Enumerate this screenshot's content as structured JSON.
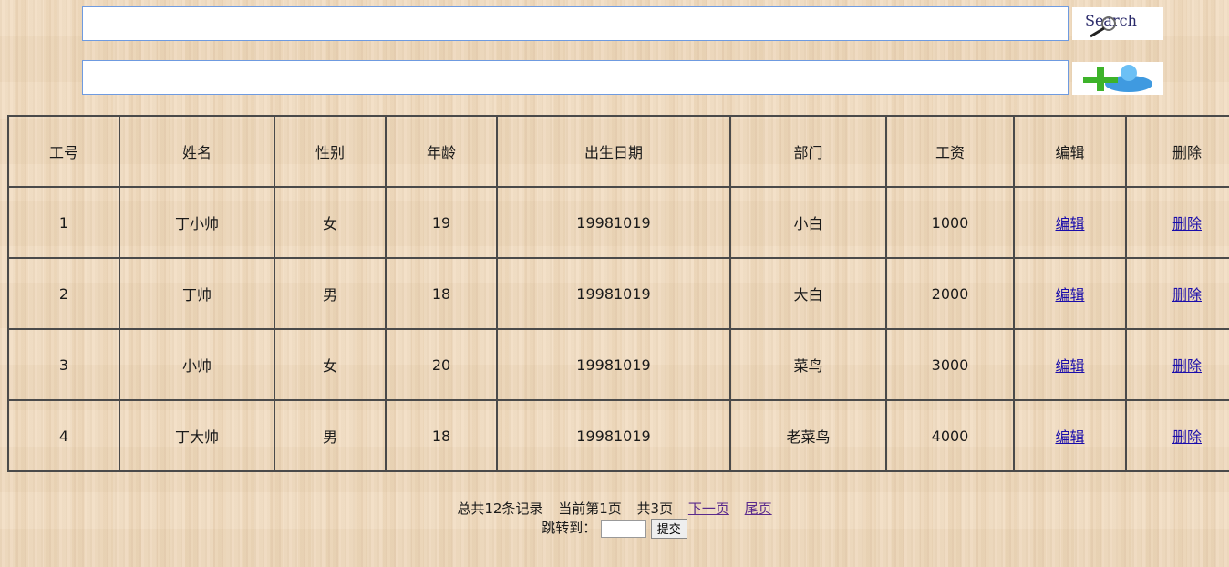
{
  "search": {
    "value": "",
    "button_label": "Search",
    "button_icon": "search-magnifier-icon"
  },
  "add": {
    "value": "",
    "button_icon": "add-user-icon"
  },
  "table": {
    "headers": [
      "工号",
      "姓名",
      "性别",
      "年龄",
      "出生日期",
      "部门",
      "工资",
      "编辑",
      "删除"
    ],
    "rows": [
      {
        "id": "1",
        "name": "丁小帅",
        "gender": "女",
        "age": "19",
        "birth": "19981019",
        "dept": "小白",
        "salary": "1000",
        "edit": "编辑",
        "delete": "删除"
      },
      {
        "id": "2",
        "name": "丁帅",
        "gender": "男",
        "age": "18",
        "birth": "19981019",
        "dept": "大白",
        "salary": "2000",
        "edit": "编辑",
        "delete": "删除"
      },
      {
        "id": "3",
        "name": "小帅",
        "gender": "女",
        "age": "20",
        "birth": "19981019",
        "dept": "菜鸟",
        "salary": "3000",
        "edit": "编辑",
        "delete": "删除"
      },
      {
        "id": "4",
        "name": "丁大帅",
        "gender": "男",
        "age": "18",
        "birth": "19981019",
        "dept": "老菜鸟",
        "salary": "4000",
        "edit": "编辑",
        "delete": "删除"
      }
    ]
  },
  "pager": {
    "total": "总共12条记录",
    "current": "当前第1页",
    "pages": "共3页",
    "next": "下一页",
    "last": "尾页",
    "jump_label": "跳转到：",
    "jump_value": "",
    "submit": "提交"
  }
}
